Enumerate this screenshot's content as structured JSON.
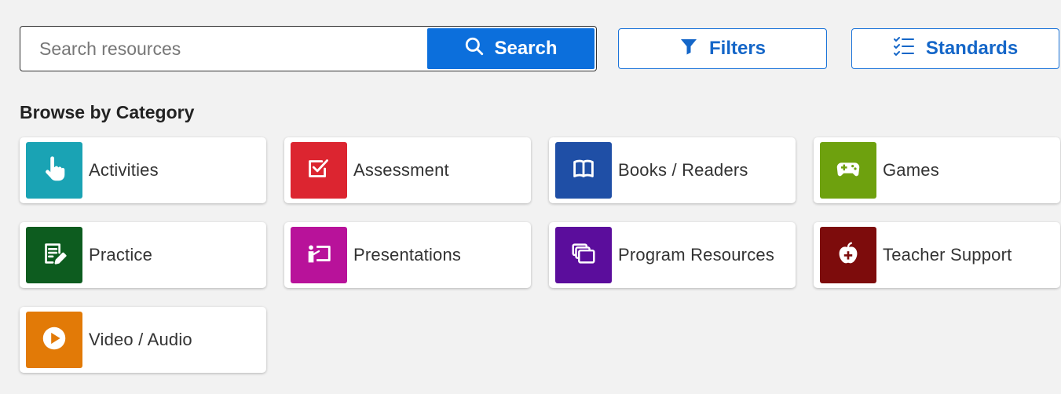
{
  "search": {
    "placeholder": "Search resources",
    "button_label": "Search"
  },
  "toolbar": {
    "filters_label": "Filters",
    "standards_label": "Standards"
  },
  "section_title": "Browse by Category",
  "colors": {
    "primary": "#0c6fdc",
    "outline": "#1a73d9"
  },
  "categories": [
    {
      "label": "Activities",
      "icon": "hand-pointer-icon",
      "color": "#1aa3b4"
    },
    {
      "label": "Assessment",
      "icon": "checkbox-icon",
      "color": "#dc2530"
    },
    {
      "label": "Books / Readers",
      "icon": "open-book-icon",
      "color": "#1f4fa6"
    },
    {
      "label": "Games",
      "icon": "gamepad-icon",
      "color": "#6ea10e"
    },
    {
      "label": "Practice",
      "icon": "edit-document-icon",
      "color": "#0d5c1f"
    },
    {
      "label": "Presentations",
      "icon": "presenter-icon",
      "color": "#b8129a"
    },
    {
      "label": "Program Resources",
      "icon": "stacked-cards-icon",
      "color": "#5b0d9c"
    },
    {
      "label": "Teacher Support",
      "icon": "apple-plus-icon",
      "color": "#7d0c0c"
    },
    {
      "label": "Video / Audio",
      "icon": "play-icon",
      "color": "#e27a07"
    }
  ]
}
